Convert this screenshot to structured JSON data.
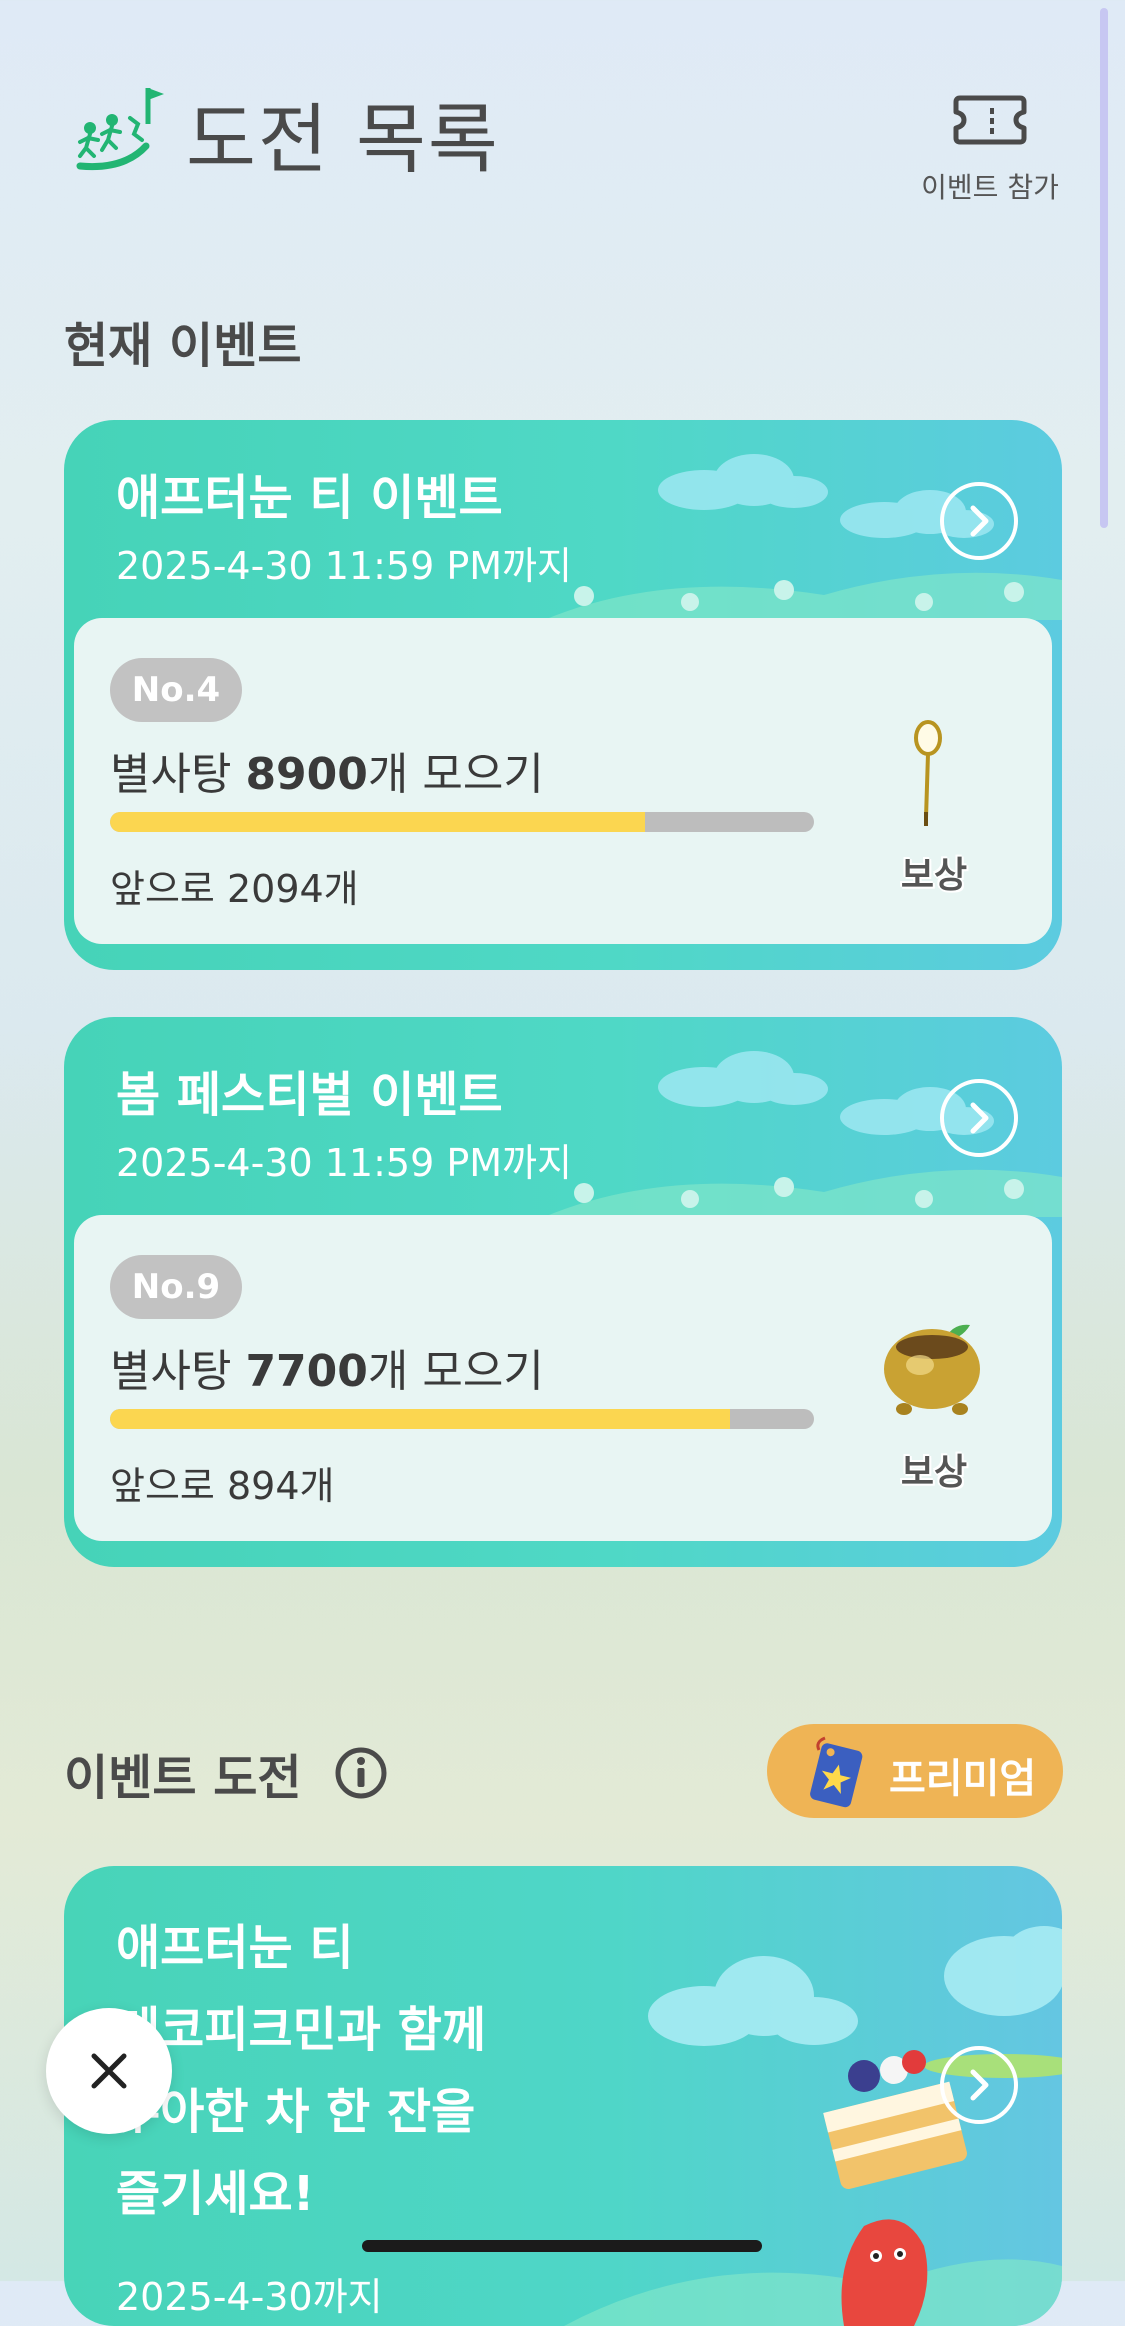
{
  "header": {
    "title": "도전 목록",
    "logo_icon": "hiking-flag-icon",
    "ticket_label": "이벤트 참가",
    "ticket_icon": "ticket-icon"
  },
  "current_events": {
    "section_title": "현재 이벤트",
    "cards": [
      {
        "title": "애프터눈 티 이벤트",
        "date": "2025-4-30 11:59 PM까지",
        "badge": "No.4",
        "goal_prefix": "별사탕 ",
        "goal_number": "8900",
        "goal_suffix": "개 모으기",
        "progress": 0.76,
        "remaining": "앞으로 2094개",
        "reward_label": "보상",
        "reward_icon": "monocle-icon"
      },
      {
        "title": "봄 페스티벌 이벤트",
        "date": "2025-4-30 11:59 PM까지",
        "badge": "No.9",
        "goal_prefix": "별사탕 ",
        "goal_number": "7700",
        "goal_suffix": "개 모으기",
        "progress": 0.88,
        "remaining": "앞으로 894개",
        "reward_label": "보상",
        "reward_icon": "golden-pot-sprout-icon"
      }
    ]
  },
  "event_challenges": {
    "section_title": "이벤트 도전",
    "info_icon": "info-icon",
    "premium_label": "프리미엄",
    "premium_icon": "star-tag-icon",
    "card": {
      "lines": [
        "애프터눈 티",
        "데코피크민과 함께",
        "우아한 차 한 잔을",
        "즐기세요!"
      ],
      "date": "2025-4-30까지"
    }
  },
  "fab": {
    "icon": "close-icon"
  },
  "colors": {
    "accent": "#4fd6c4",
    "progress": "#fbd650",
    "premium": "#efb455"
  }
}
